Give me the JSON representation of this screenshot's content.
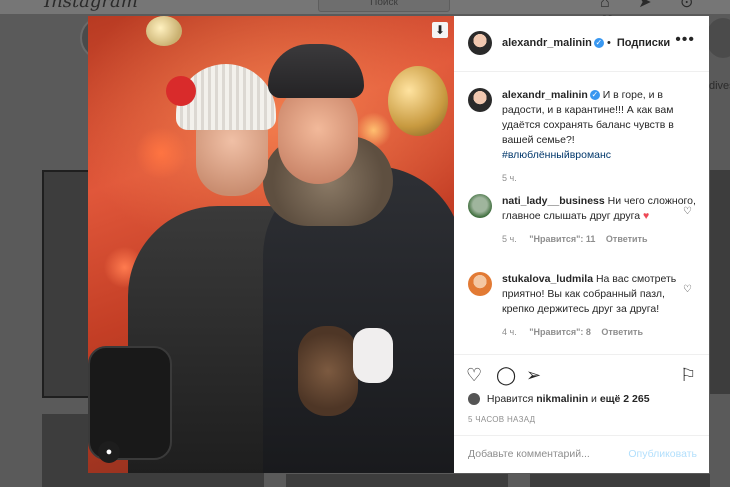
{
  "background": {
    "logo": "Instagram",
    "search_placeholder": "Поиск",
    "nav_icons": [
      "home-icon",
      "send-icon",
      "explore-icon",
      "heart-icon"
    ],
    "right_text": "dives"
  },
  "post": {
    "author": "alexandr_malinin",
    "separator": "•",
    "follow_label": "Подписки",
    "more_label": "•••",
    "caption": {
      "username": "alexandr_malinin",
      "text": "И в горе, и в радости, и в карантине!!! А как вам удаётся сохранять баланс чувств в вашей семье?!",
      "hashtag": "#влюблённыйвроманс",
      "time": "5 ч."
    },
    "comments": [
      {
        "username": "nati_lady__business",
        "text": "Ни чего сложного, главное слышать друг друга",
        "emoji": "♥",
        "time": "5 ч.",
        "likes": "\"Нравится\": 11",
        "reply": "Ответить"
      },
      {
        "username": "stukalova_ludmila",
        "text": "На вас смотреть приятно! Вы как собранный пазл, крепко держитесь друг за друга!",
        "time": "4 ч.",
        "likes": "\"Нравится\": 8",
        "reply": "Ответить"
      }
    ],
    "likes_prefix": "Нравится",
    "liked_by": "nikmalinin",
    "likes_suffix_pre": "и",
    "likes_count_text": "ещё 2 265",
    "time_ago": "5 ЧАСОВ НАЗАД",
    "add_comment_placeholder": "Добавьте комментарий...",
    "publish_label": "Опубликовать"
  }
}
